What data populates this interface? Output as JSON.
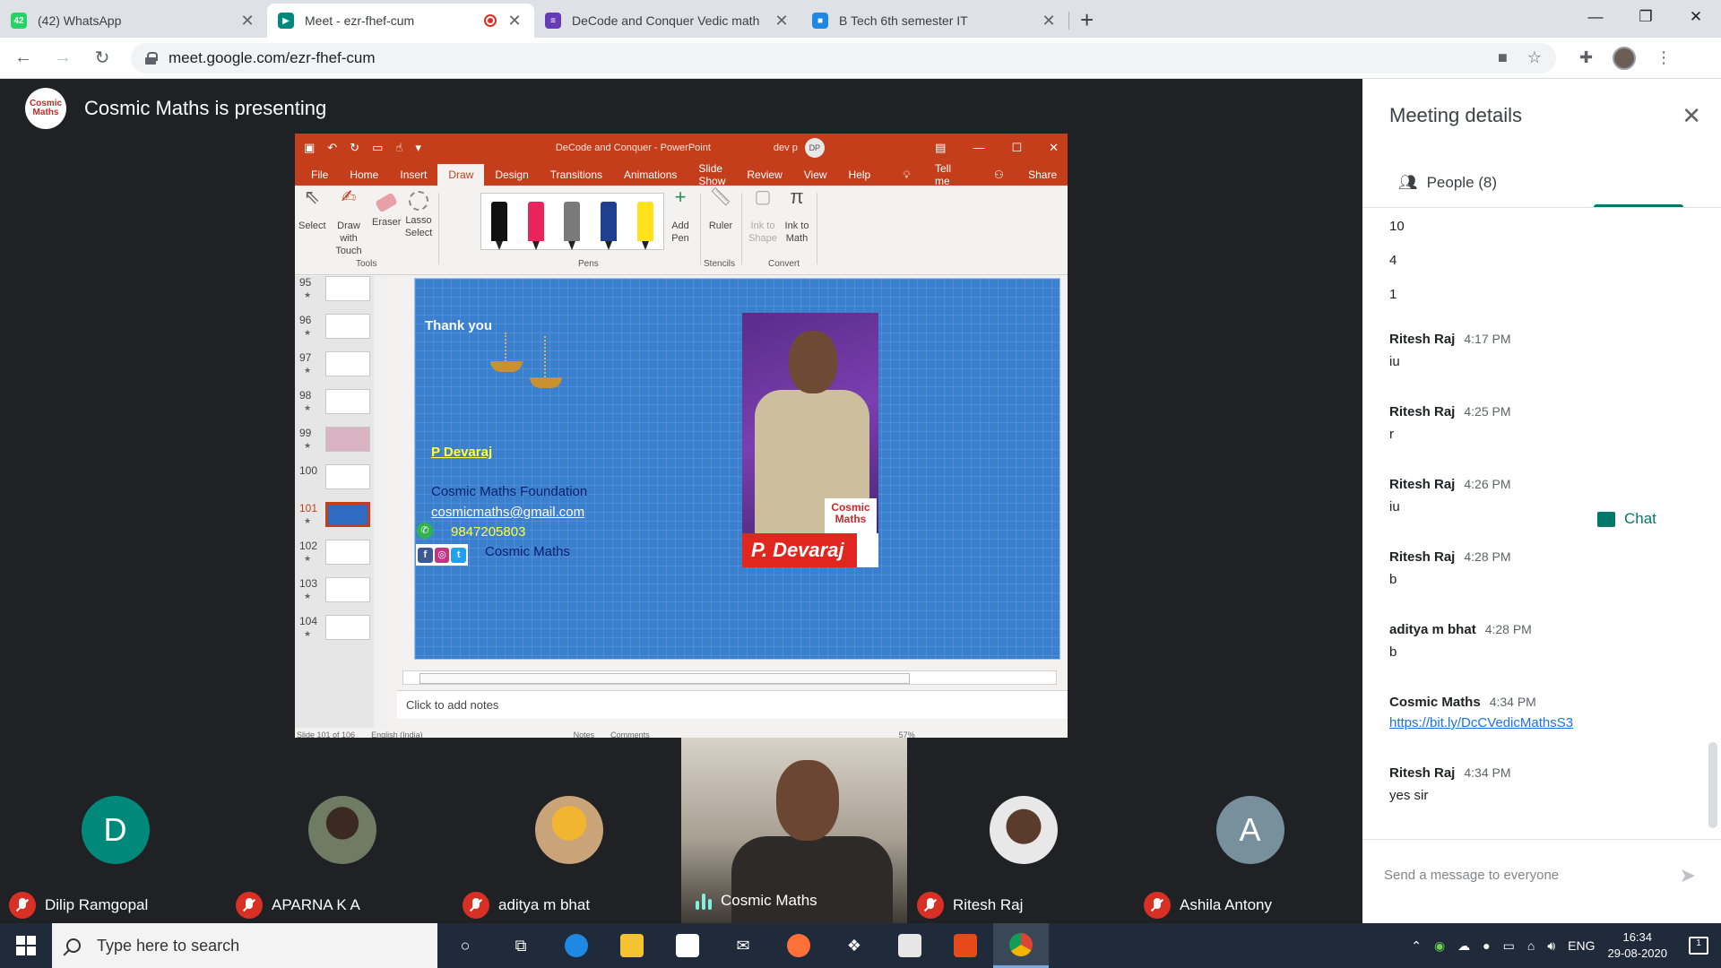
{
  "browser": {
    "tabs": [
      {
        "title": "(42) WhatsApp",
        "favicon": "whatsapp-icon",
        "color": "#25d366",
        "badge": "42"
      },
      {
        "title": "Meet - ezr-fhef-cum",
        "favicon": "meet-icon",
        "color": "#00897b",
        "recording": true
      },
      {
        "title": "DeCode and Conquer Vedic math",
        "favicon": "forms-icon",
        "color": "#673ab7"
      },
      {
        "title": "B Tech 6th semester IT",
        "favicon": "classroom-icon",
        "color": "#1e88e5"
      }
    ],
    "url": "meet.google.com/ezr-fhef-cum"
  },
  "meet": {
    "presenter_banner": "Cosmic Maths is presenting",
    "presenter_logo_text": "Cosmic Maths"
  },
  "ppt": {
    "title": "DeCode and Conquer - PowerPoint",
    "user": "dev p",
    "user_initials": "DP",
    "menu": [
      "File",
      "Home",
      "Insert",
      "Draw",
      "Design",
      "Transitions",
      "Animations",
      "Slide Show",
      "Review",
      "View",
      "Help",
      "Tell me",
      "Share"
    ],
    "active_menu": "Draw",
    "ribbon": {
      "select": "Select",
      "draw_touch": "Draw with Touch",
      "eraser": "Eraser",
      "lasso": "Lasso Select",
      "tools_group": "Tools",
      "add_pen": "Add Pen",
      "pens_group": "Pens",
      "ruler": "Ruler",
      "stencils_group": "Stencils",
      "ink_shape": "Ink to Shape",
      "ink_math": "Ink to Math",
      "convert_group": "Convert",
      "pen_colors": [
        "#111111",
        "#e8245c",
        "#7a7a7a",
        "#1f3f8f",
        "#ffe21a"
      ]
    },
    "thumbnails": [
      "95",
      "96",
      "97",
      "98",
      "99",
      "100",
      "101",
      "102",
      "103",
      "104"
    ],
    "current_slide": "101",
    "slide": {
      "thank": "Thank you",
      "name": "P Devaraj",
      "foundation": "Cosmic Maths Foundation",
      "email": "cosmicmaths@gmail.com",
      "phone": "9847205803",
      "brand": "Cosmic Maths",
      "photo_caption": "P. Devaraj",
      "photo_logo": "Cosmic Maths"
    },
    "notes_placeholder": "Click to add notes",
    "status": {
      "slide": "Slide 101 of 106",
      "language": "English (India)",
      "notes": "Notes",
      "comments": "Comments",
      "zoom": "57%"
    }
  },
  "panel": {
    "title": "Meeting details",
    "people_tab": "People (8)",
    "chat_tab": "Chat",
    "plain_messages": [
      "10",
      "4",
      "1"
    ],
    "messages": [
      {
        "sender": "Ritesh Raj",
        "time": "4:17 PM",
        "text": "iu"
      },
      {
        "sender": "Ritesh Raj",
        "time": "4:25 PM",
        "text": "r"
      },
      {
        "sender": "Ritesh Raj",
        "time": "4:26 PM",
        "text": "iu"
      },
      {
        "sender": "Ritesh Raj",
        "time": "4:28 PM",
        "text": "b"
      },
      {
        "sender": "aditya m bhat",
        "time": "4:28 PM",
        "text": "b"
      },
      {
        "sender": "Cosmic Maths",
        "time": "4:34 PM",
        "link": "https://bit.ly/DcCVedicMathsS3"
      },
      {
        "sender": "Ritesh Raj",
        "time": "4:34 PM",
        "text": "yes sir"
      }
    ],
    "input_placeholder": "Send a message to everyone"
  },
  "participants": [
    {
      "name": "Dilip Ramgopal",
      "initial": "D",
      "avatar_color": "#00897b",
      "muted": true
    },
    {
      "name": "APARNA K A",
      "initial": "",
      "avatar_color": "#5d6b52",
      "muted": true
    },
    {
      "name": "aditya m bhat",
      "initial": "",
      "avatar_color": "#d9a035",
      "muted": true
    },
    {
      "name": "Cosmic Maths",
      "initial": "",
      "avatar_color": "",
      "muted": false,
      "speaking": true
    },
    {
      "name": "Ritesh Raj",
      "initial": "",
      "avatar_color": "#3a3a3a",
      "muted": true
    },
    {
      "name": "Ashila Antony",
      "initial": "A",
      "avatar_color": "#78909c",
      "muted": true
    }
  ],
  "taskbar": {
    "search_placeholder": "Type here to search",
    "language": "ENG",
    "time": "16:34",
    "date": "29-08-2020",
    "notifications": "1"
  }
}
